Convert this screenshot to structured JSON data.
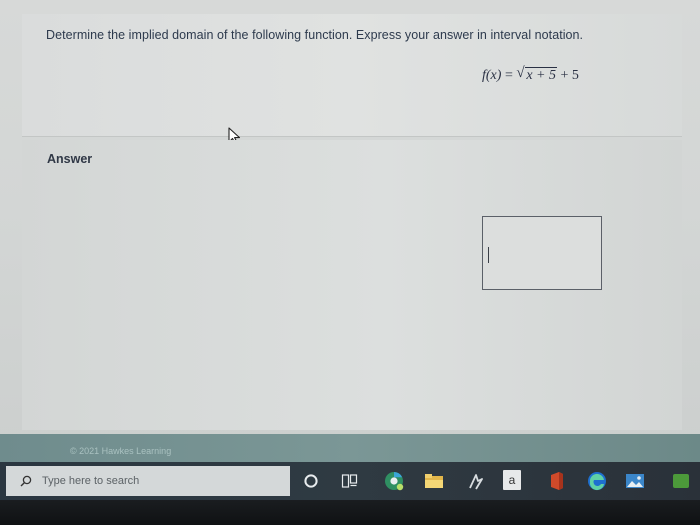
{
  "question": {
    "prompt": "Determine the implied domain of the following function. Express your answer in interval notation.",
    "equation": {
      "lhs": "f(x)",
      "equals": "=",
      "radicand": "x + 5",
      "tail": "+ 5"
    }
  },
  "answer": {
    "label": "Answer",
    "value": ""
  },
  "footer": {
    "copyright": "© 2021 Hawkes Learning"
  },
  "taskbar": {
    "search_placeholder": "Type here to search",
    "store_letter": "a"
  }
}
